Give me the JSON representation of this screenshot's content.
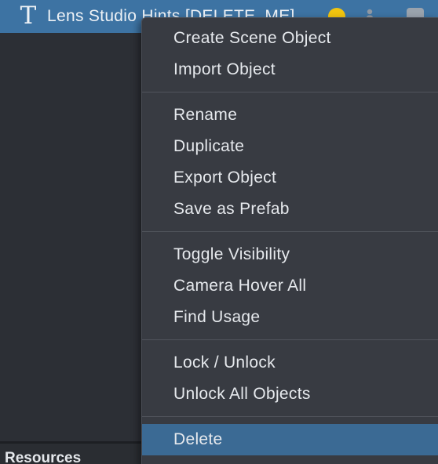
{
  "hierarchy": {
    "selected_row": {
      "icon": "text-object-icon",
      "icon_glyph": "T",
      "label": "Lens Studio Hints [DELETE_ME]",
      "status_color": "#f1c40f"
    }
  },
  "panels": {
    "resources_title": "Resources"
  },
  "context_menu": {
    "groups": [
      {
        "items": [
          "Create Scene Object",
          "Import Object"
        ]
      },
      {
        "items": [
          "Rename",
          "Duplicate",
          "Export Object",
          "Save as Prefab"
        ]
      },
      {
        "items": [
          "Toggle Visibility",
          "Camera Hover All",
          "Find Usage"
        ]
      },
      {
        "items": [
          "Lock / Unlock",
          "Unlock All Objects"
        ]
      },
      {
        "items": [
          "Delete"
        ]
      }
    ],
    "highlighted_item": "Delete"
  },
  "colors": {
    "selection": "#3d73a3",
    "menu_background": "#383b42",
    "menu_highlight": "#3b6a94",
    "panel_background": "#2c2f35"
  }
}
